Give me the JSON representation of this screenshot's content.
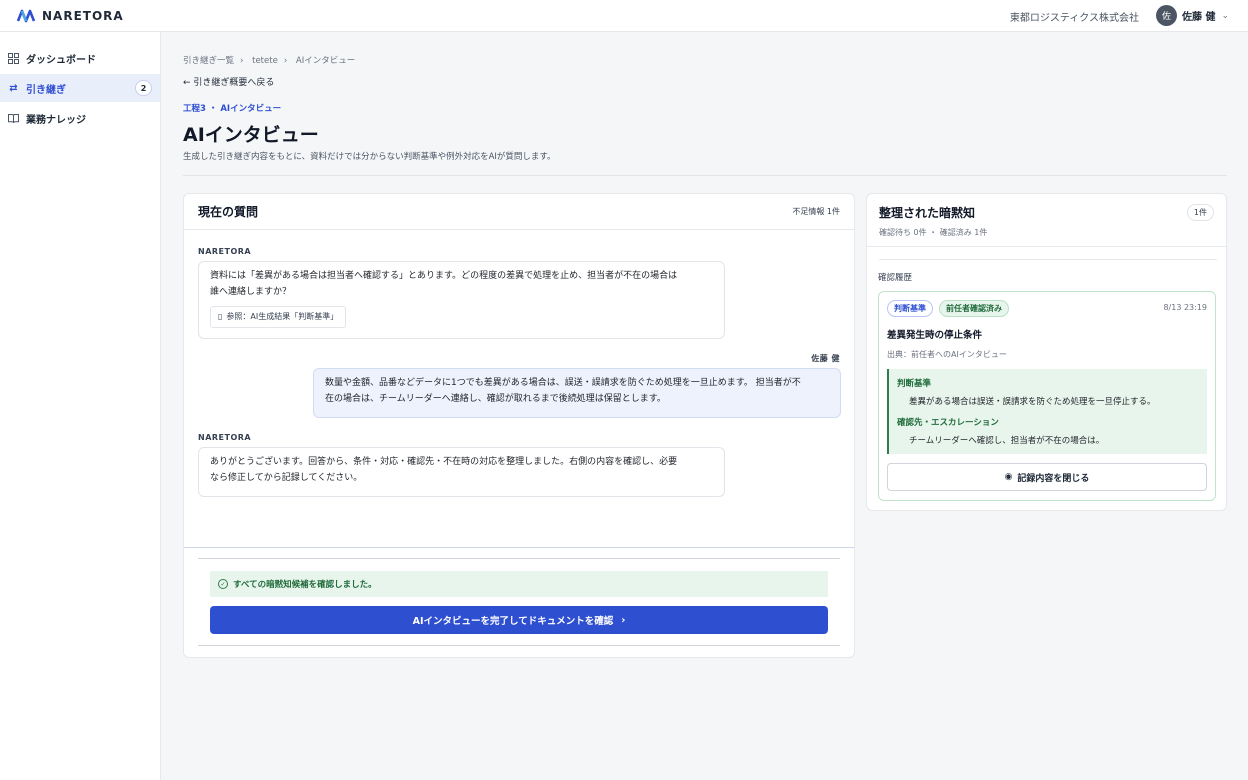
{
  "brand": {
    "name": "NARETORA",
    "accent": "#2f4fd1"
  },
  "header": {
    "company": "東都ロジスティクス株式会社",
    "user_initial": "佐",
    "user_name": "佐藤 健"
  },
  "sidebar": {
    "items": [
      {
        "label": "ダッシュボード",
        "icon": "dashboard-icon"
      },
      {
        "label": "引き継ぎ",
        "icon": "swap-icon",
        "count": "2",
        "active": true
      },
      {
        "label": "業務ナレッジ",
        "icon": "book-icon"
      }
    ]
  },
  "breadcrumb": [
    "引き継ぎ一覧",
    "tetete",
    "AIインタビュー"
  ],
  "back_label": "引き継ぎ概要へ戻る",
  "step_label": "工程3 ・ AIインタビュー",
  "page_title": "AIインタビュー",
  "page_subtitle": "生成した引き継ぎ内容をもとに、資料だけでは分からない判断基準や例外対応をAIが質問します。",
  "question_panel": {
    "title": "現在の質問",
    "missing_info": "不足情報 1件",
    "messages": [
      {
        "sender": "NARETORA",
        "line1": "資料には「差異がある場合は担当者へ確認する」とあります。どの程度の差異で処理を止め、担当者が不在の場合は",
        "line2": "誰へ連絡しますか？",
        "ref": "参照：AI生成結果「判断基準」"
      },
      {
        "sender": "佐藤 健",
        "line1": "数量や金額、品番などデータに1つでも差異がある場合は、誤送・誤請求を防ぐため処理を一旦止めます。 担当者が不",
        "line2": "在の場合は、チームリーダーへ連絡し、確認が取れるまで後続処理は保留とします。"
      },
      {
        "sender": "NARETORA",
        "line1": "ありがとうございます。回答から、条件・対応・確認先・不在時の対応を整理しました。右側の内容を確認し、必要",
        "line2": "なら修正してから記録してください。"
      }
    ],
    "done_message": "すべての暗黙知候補を確認しました。",
    "finish_button": "AIインタビューを完了してドキュメントを確認"
  },
  "knowledge_panel": {
    "title": "整理された暗黙知",
    "summary": "確認待ち 0件 ・ 確認済み 1件",
    "badge": "1件",
    "history_label": "確認履歴",
    "item": {
      "tag1": "判断基準",
      "tag2": "前任者確認済み",
      "date": "8/13 23:19",
      "title": "差異発生時の停止条件",
      "source": "出典：前任者へのAIインタビュー",
      "sections": [
        {
          "heading": "判断基準",
          "text": "差異がある場合は誤送・誤請求を防ぐため処理を一旦停止する。"
        },
        {
          "heading": "確認先・エスカレーション",
          "text": "チームリーダーへ確認し、担当者が不在の場合は。"
        }
      ],
      "close_button": "記録内容を閉じる"
    }
  }
}
